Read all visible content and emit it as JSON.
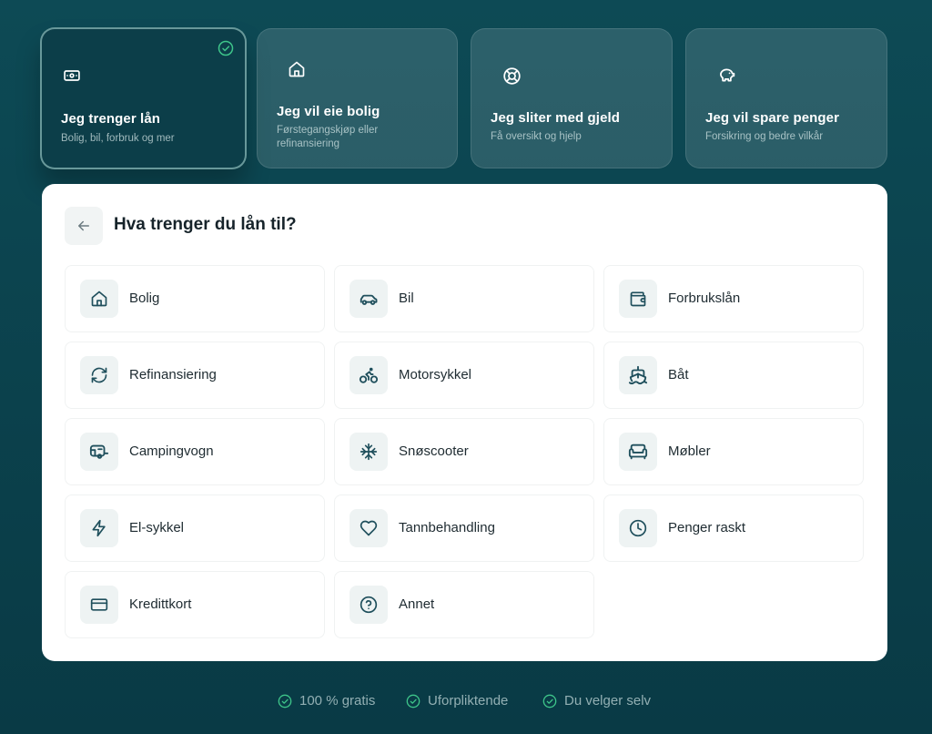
{
  "cards": [
    {
      "title": "Jeg trenger lån",
      "subtitle": "Bolig, bil, forbruk og mer",
      "icon": "banknote-icon",
      "selected": true
    },
    {
      "title": "Jeg vil eie bolig",
      "subtitle": "Førstegangskjøp eller refinansiering",
      "icon": "home-icon",
      "selected": false
    },
    {
      "title": "Jeg sliter med gjeld",
      "subtitle": "Få oversikt og hjelp",
      "icon": "lifebuoy-icon",
      "selected": false
    },
    {
      "title": "Jeg vil spare penger",
      "subtitle": "Forsikring og bedre vilkår",
      "icon": "piggy-bank-icon",
      "selected": false
    }
  ],
  "panel": {
    "title": "Hva trenger du lån til?",
    "options": [
      {
        "label": "Bolig",
        "icon": "home-icon"
      },
      {
        "label": "Bil",
        "icon": "car-icon"
      },
      {
        "label": "Forbrukslån",
        "icon": "wallet-icon"
      },
      {
        "label": "Refinansiering",
        "icon": "refresh-icon"
      },
      {
        "label": "Motorsykkel",
        "icon": "bike-icon"
      },
      {
        "label": "Båt",
        "icon": "ship-icon"
      },
      {
        "label": "Campingvogn",
        "icon": "caravan-icon"
      },
      {
        "label": "Snøscooter",
        "icon": "snowflake-icon"
      },
      {
        "label": "Møbler",
        "icon": "sofa-icon"
      },
      {
        "label": "El-sykkel",
        "icon": "zap-icon"
      },
      {
        "label": "Tannbehandling",
        "icon": "heart-icon"
      },
      {
        "label": "Penger raskt",
        "icon": "clock-icon"
      },
      {
        "label": "Kredittkort",
        "icon": "credit-card-icon"
      },
      {
        "label": "Annet",
        "icon": "help-circle-icon"
      }
    ]
  },
  "footer": [
    {
      "label": "100 % gratis"
    },
    {
      "label": "Uforpliktende"
    },
    {
      "label": "Du velger selv"
    }
  ],
  "colors": {
    "background": "#0b414c",
    "accent_check": "#3ec58a",
    "icon_stroke": "#1f4f5c"
  }
}
